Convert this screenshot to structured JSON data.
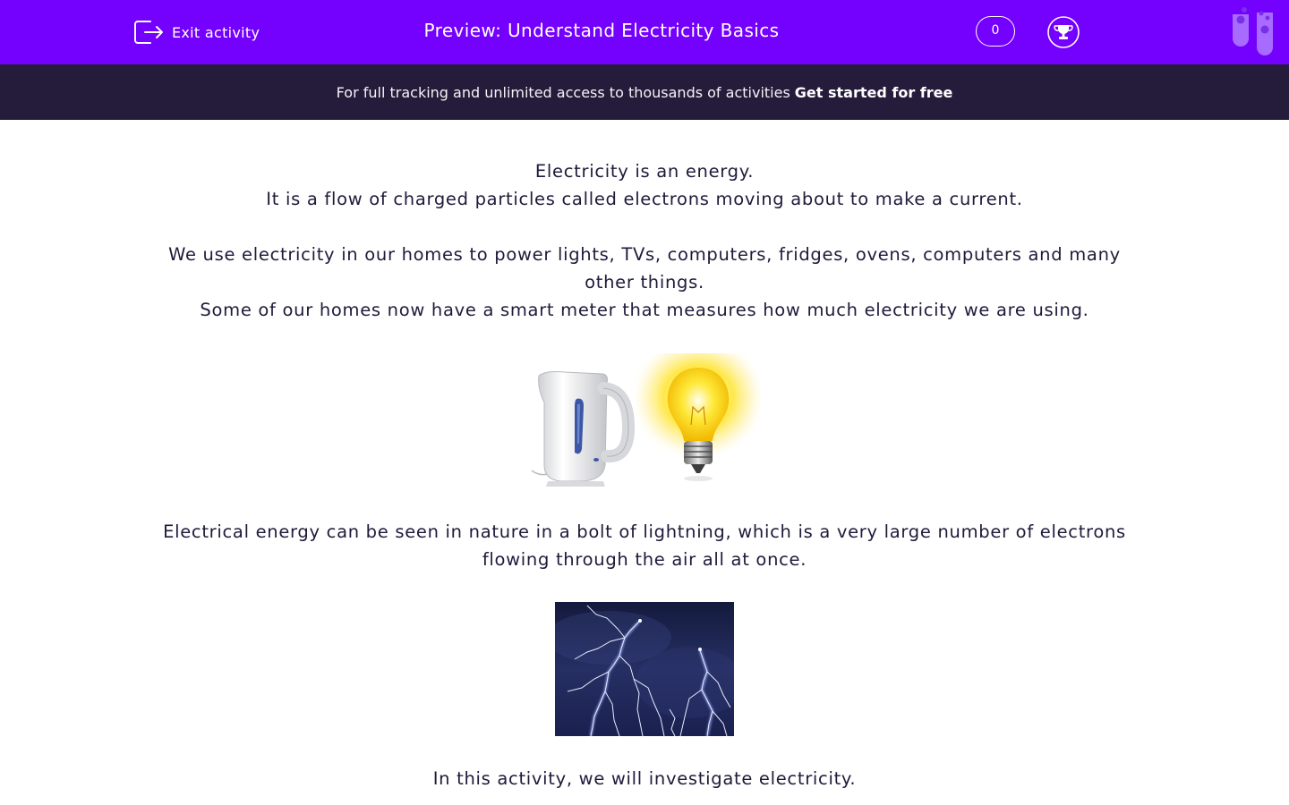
{
  "header": {
    "exit_label": "Exit activity",
    "title": "Preview: Understand Electricity Basics",
    "score": "0"
  },
  "banner": {
    "lead": "For full tracking and unlimited access to thousands of activities",
    "cta": "Get started for free"
  },
  "content": {
    "line1": "Electricity is an energy.",
    "line2": "It is a flow of charged particles called electrons moving about to make a current.",
    "line3": "We use electricity in our homes to power lights, TVs, computers, fridges, ovens, computers and many other things.",
    "line4": "Some of our homes now have a smart meter that measures how much electricity we are using.",
    "line5": "Electrical energy can be seen in nature in a bolt of lightning, which is a very large number of electrons flowing through the air all at once.",
    "line6": "In this activity, we will investigate electricity."
  },
  "colors": {
    "topbar": "#7400fd",
    "banner": "#251c3b",
    "text": "#1f1a3a"
  },
  "icons": [
    "exit-icon",
    "trophy-icon",
    "test-tubes-logo-icon",
    "kettle-image",
    "light-bulb-image",
    "lightning-image"
  ]
}
